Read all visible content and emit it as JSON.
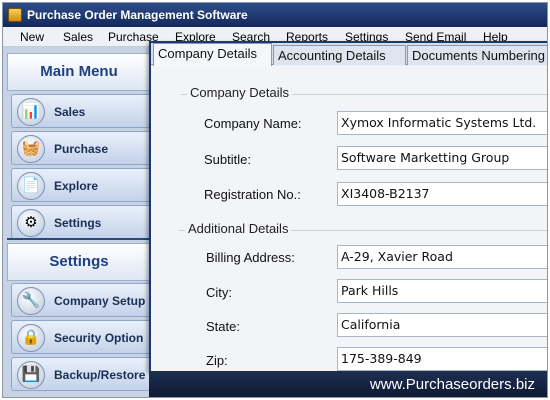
{
  "window": {
    "title": "Purchase Order Management Software"
  },
  "menu": [
    "New",
    "Sales",
    "Purchase",
    "Explore",
    "Search",
    "Reports",
    "Settings",
    "Send Email",
    "Help"
  ],
  "sidebar": {
    "main_header": "Main Menu",
    "main_items": [
      {
        "label": "Sales",
        "icon": "sales-chart-icon"
      },
      {
        "label": "Purchase",
        "icon": "purchase-basket-icon"
      },
      {
        "label": "Explore",
        "icon": "explore-document-icon"
      },
      {
        "label": "Settings",
        "icon": "settings-gear-icon"
      }
    ],
    "settings_header": "Settings",
    "settings_items": [
      {
        "label": "Company Setup",
        "icon": "company-setup-icon"
      },
      {
        "label": "Security Option",
        "icon": "security-lock-icon"
      },
      {
        "label": "Backup/Restore",
        "icon": "backup-restore-icon"
      }
    ]
  },
  "tabs": [
    "Company Details",
    "Accounting Details",
    "Documents Numbering"
  ],
  "active_tab": "Company Details",
  "company_details": {
    "legend": "Company Details",
    "fields": [
      {
        "label": "Company Name:",
        "value": "Xymox Informatic Systems Ltd."
      },
      {
        "label": "Subtitle:",
        "value": "Software Marketting Group"
      },
      {
        "label": "Registration No.:",
        "value": "XI3408-B2137"
      }
    ]
  },
  "additional_details": {
    "legend": "Additional Details",
    "fields": [
      {
        "label": "Billing Address:",
        "value": "A-29, Xavier Road"
      },
      {
        "label": "City:",
        "value": "Park Hills"
      },
      {
        "label": "State:",
        "value": "California"
      },
      {
        "label": "Zip:",
        "value": "175-389-849"
      }
    ]
  },
  "footer": {
    "url": "www.Purchaseorders.biz"
  },
  "colors": {
    "titlebar": "#1f3a6e",
    "sidebar": "#c7d3e4",
    "footer": "#0d1730"
  }
}
